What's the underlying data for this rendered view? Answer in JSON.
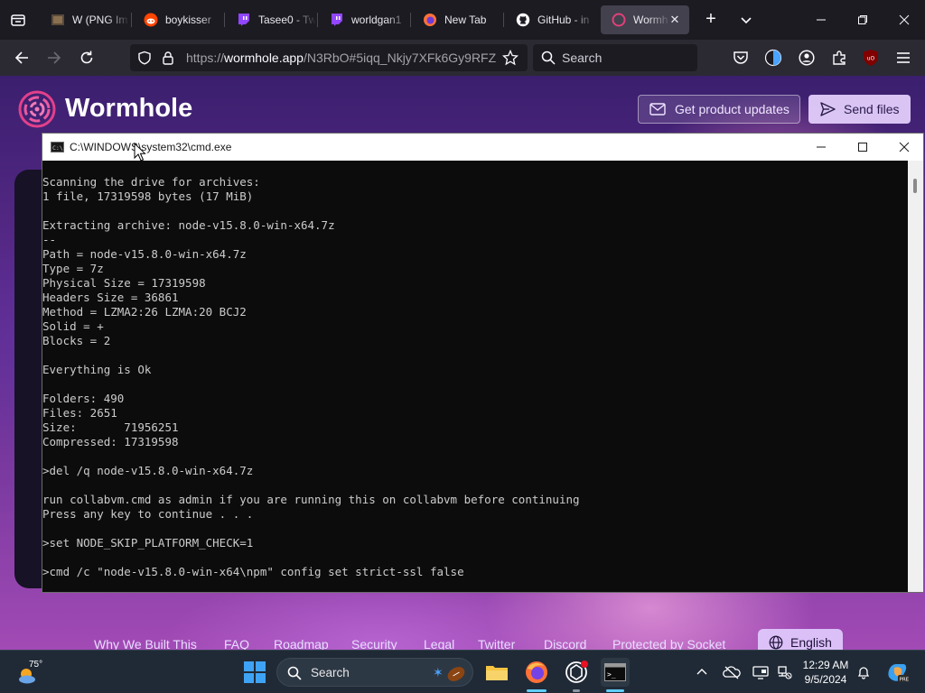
{
  "browser": {
    "tabs": [
      {
        "title": "W (PNG Im",
        "icon": "wikimedia-icon"
      },
      {
        "title": "boykisser",
        "icon": "reddit-icon"
      },
      {
        "title": "Tasee0 - Tw",
        "icon": "twitch-icon"
      },
      {
        "title": "worldgan1",
        "icon": "twitch-icon"
      },
      {
        "title": "New Tab",
        "icon": "firefox-icon"
      },
      {
        "title": "GitHub - in",
        "icon": "github-icon"
      },
      {
        "title": "Wormh",
        "icon": "wormhole-icon",
        "active": true
      }
    ],
    "url": {
      "scheme": "https://",
      "host": "wormhole.app",
      "path": "/N3RbO#5iqq_Nkjy7XFk6Gy9RFZ"
    },
    "search_placeholder": "Search",
    "accent_color": "#42414d"
  },
  "site": {
    "brand": "Wormhole",
    "updates_button": "Get product updates",
    "send_button": "Send files",
    "footer_links": [
      "Why We Built This",
      "FAQ",
      "Roadmap",
      "Security",
      "Legal",
      "Twitter",
      "Discord",
      "Protected by Socket"
    ],
    "language_button": "English"
  },
  "cmd": {
    "title": "C:\\WINDOWS\\system32\\cmd.exe",
    "lines": [
      "Scanning the drive for archives:",
      "1 file, 17319598 bytes (17 MiB)",
      "",
      "Extracting archive: node-v15.8.0-win-x64.7z",
      "--",
      "Path = node-v15.8.0-win-x64.7z",
      "Type = 7z",
      "Physical Size = 17319598",
      "Headers Size = 36861",
      "Method = LZMA2:26 LZMA:20 BCJ2",
      "Solid = +",
      "Blocks = 2",
      "",
      "Everything is Ok",
      "",
      "Folders: 490",
      "Files: 2651",
      "Size:       71956251",
      "Compressed: 17319598",
      "",
      ">del /q node-v15.8.0-win-x64.7z",
      "",
      "run collabvm.cmd as admin if you are running this on collabvm before continuing",
      "Press any key to continue . . .",
      "",
      ">set NODE_SKIP_PLATFORM_CHECK=1",
      "",
      ">cmd /c \"node-v15.8.0-win-x64\\npm\" config set strict-ssl false"
    ]
  },
  "taskbar": {
    "weather_temp": "75°",
    "search_placeholder": "Search",
    "time": "12:29 AM",
    "date": "9/5/2024"
  }
}
